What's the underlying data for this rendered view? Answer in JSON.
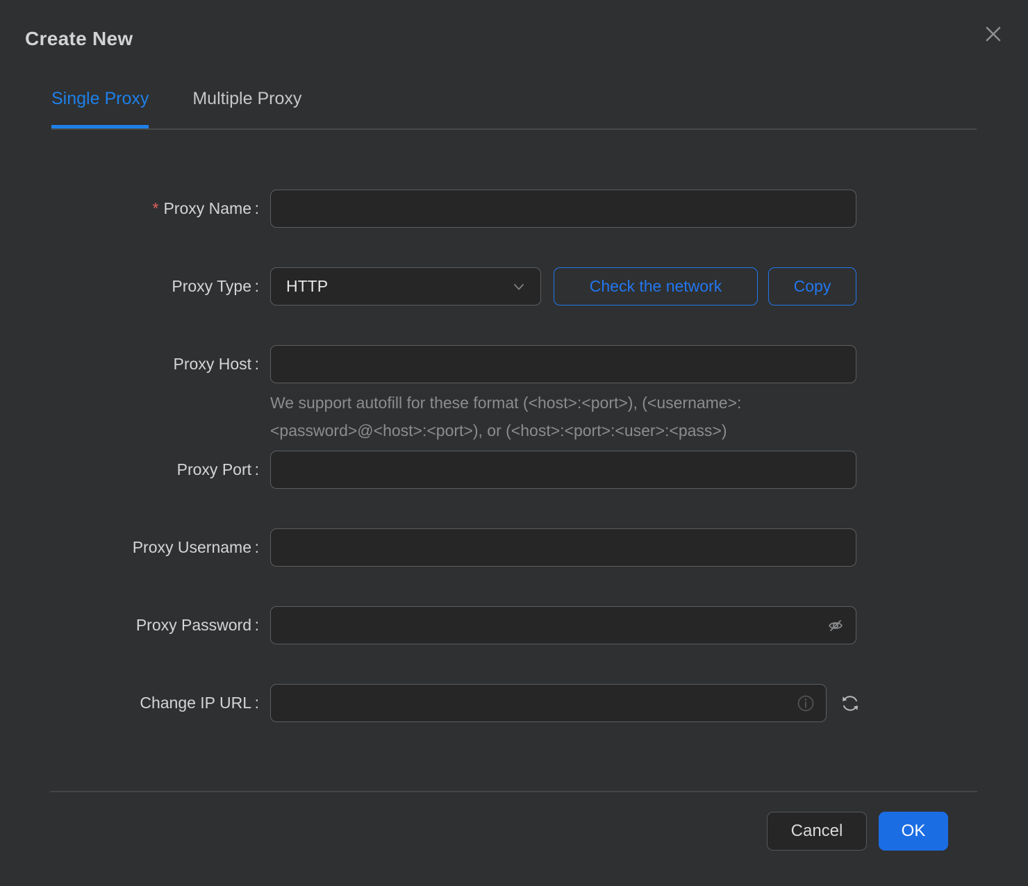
{
  "colors": {
    "bg": "#2f3031",
    "title": "#d2d3d4",
    "tab_inactive": "#c6c7c8",
    "tab_active": "#1e80ea",
    "tab_line": "#48494a",
    "accent": "#2277f0",
    "ok_bg": "#1b6de4",
    "input_bg": "#262627",
    "input_border": "#5d5e5f",
    "label": "#d4d5d6",
    "value": "#e6e7e8",
    "helper": "#8c8d8f",
    "divider": "#454647",
    "close_icon": "#8e8f90",
    "chevron": "#7f8082",
    "eye_icon": "#8c8d8f",
    "info_icon": "#515253",
    "refresh_icon": "#b8b9bb",
    "red": "#e25e5e",
    "cancel_bg": "#262627",
    "cancel_border": "#56575a",
    "cancel_text": "#d8d9da"
  },
  "dialog": {
    "title": "Create New",
    "tabs": {
      "single": {
        "label": "Single Proxy",
        "active": true
      },
      "multiple": {
        "label": "Multiple Proxy",
        "active": false
      }
    },
    "form": {
      "required_mark": "*",
      "proxy_name": {
        "label": "Proxy Name :",
        "value": ""
      },
      "proxy_type": {
        "label": "Proxy Type :",
        "selected": "HTTP"
      },
      "check_network_label": "Check the network",
      "copy_label": "Copy",
      "proxy_host": {
        "label": "Proxy Host :",
        "value": "",
        "helper_line1": "We support autofill for these format (<host>:<port>), (<username>:",
        "helper_line2": "<password>@<host>:<port>), or (<host>:<port>:<user>:<pass>)"
      },
      "proxy_port": {
        "label": "Proxy Port :",
        "value": ""
      },
      "proxy_username": {
        "label": "Proxy Username :",
        "value": ""
      },
      "proxy_password": {
        "label": "Proxy Password :",
        "value": ""
      },
      "change_ip_url": {
        "label": "Change IP URL :",
        "value": ""
      }
    },
    "footer": {
      "cancel_label": "Cancel",
      "ok_label": "OK"
    }
  }
}
